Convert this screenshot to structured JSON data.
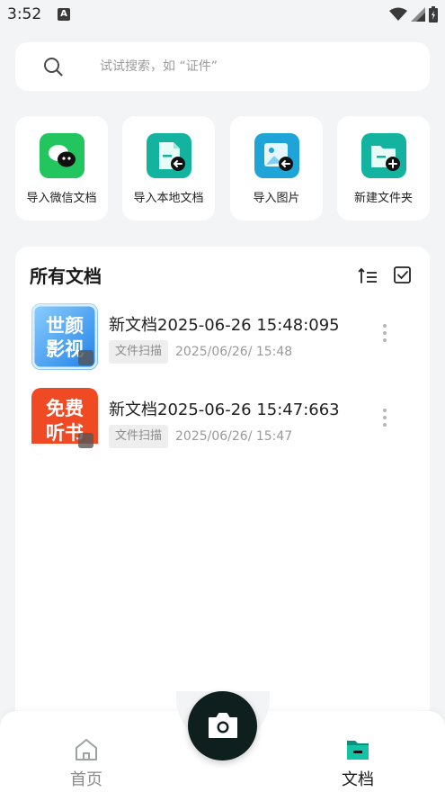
{
  "status_bar": {
    "time": "3:52",
    "notification_icon": "text-a-icon"
  },
  "search": {
    "placeholder": "试试搜索，如 “证件”"
  },
  "quick_actions": [
    {
      "label": "导入微信文档",
      "icon": "wechat-icon",
      "color": "#22c55e"
    },
    {
      "label": "导入本地文档",
      "icon": "local-doc-import-icon",
      "color": "#13b3a0"
    },
    {
      "label": "导入图片",
      "icon": "image-import-icon",
      "color": "#1fa4d8"
    },
    {
      "label": "新建文件夹",
      "icon": "new-folder-icon",
      "color": "#13b3a0"
    }
  ],
  "documents_section": {
    "title": "所有文档",
    "items": [
      {
        "name": "新文档2025-06-26 15:48:095",
        "tag": "文件扫描",
        "time": "2025/06/26/ 15:48",
        "thumb_text": [
          "世颜",
          "影视"
        ]
      },
      {
        "name": "新文档2025-06-26 15:47:663",
        "tag": "文件扫描",
        "time": "2025/06/26/ 15:47",
        "thumb_text": [
          "免费",
          "听书"
        ]
      }
    ]
  },
  "bottom_nav": {
    "home_label": "首页",
    "docs_label": "文档",
    "accent": "#0b8f7c"
  }
}
